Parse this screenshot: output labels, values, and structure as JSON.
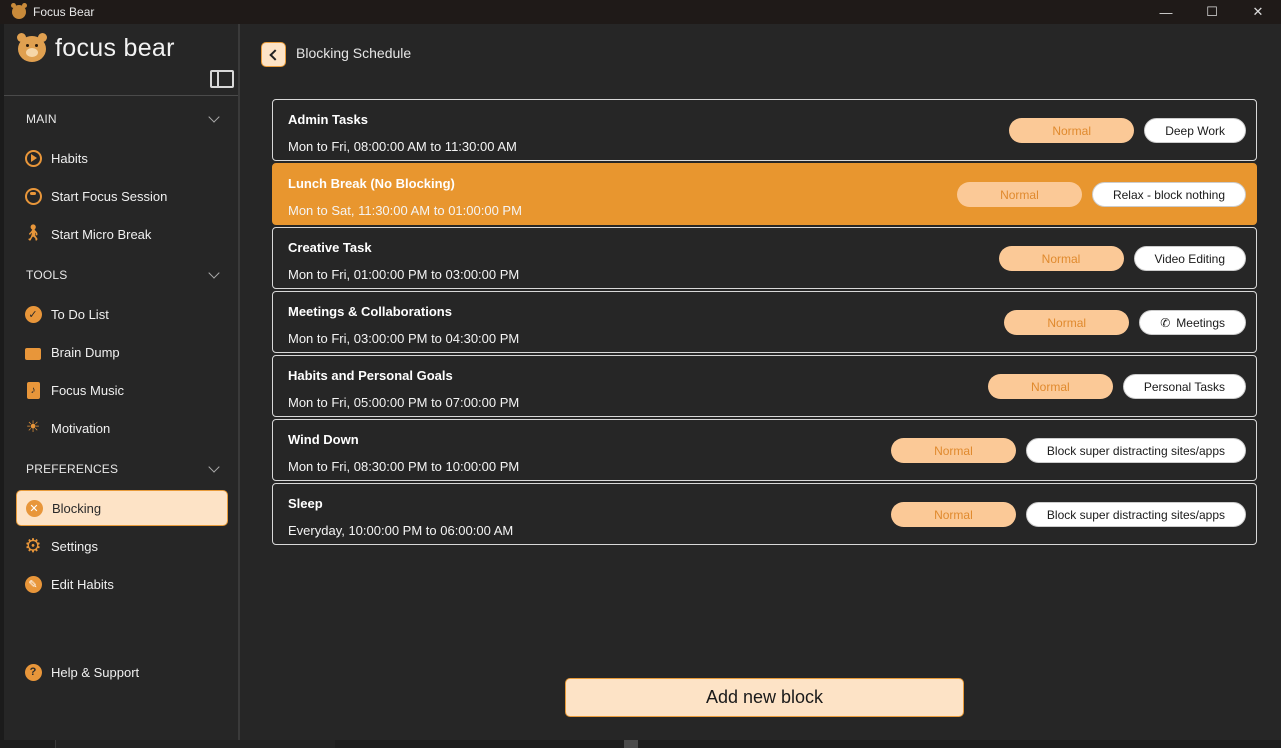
{
  "window": {
    "title": "Focus Bear"
  },
  "brand": {
    "name": "focus bear"
  },
  "sidebar": {
    "sections": [
      {
        "label": "MAIN",
        "items": [
          {
            "label": "Habits",
            "icon": "play-circle-icon"
          },
          {
            "label": "Start Focus Session",
            "icon": "timer-icon"
          },
          {
            "label": "Start Micro Break",
            "icon": "walking-person-icon"
          }
        ]
      },
      {
        "label": "TOOLS",
        "items": [
          {
            "label": "To Do List",
            "icon": "checkmark-badge-icon"
          },
          {
            "label": "Brain Dump",
            "icon": "open-box-icon"
          },
          {
            "label": "Focus Music",
            "icon": "music-note-icon"
          },
          {
            "label": "Motivation",
            "icon": "sun-icon"
          }
        ]
      },
      {
        "label": "PREFERENCES",
        "items": [
          {
            "label": "Blocking",
            "icon": "shield-x-icon",
            "active": true
          },
          {
            "label": "Settings",
            "icon": "gear-icon"
          },
          {
            "label": "Edit Habits",
            "icon": "pencil-icon"
          }
        ]
      }
    ],
    "help": {
      "label": "Help & Support",
      "icon": "question-icon"
    }
  },
  "header": {
    "title": "Blocking Schedule"
  },
  "blocks": [
    {
      "name": "Admin Tasks",
      "time": "Mon to Fri, 08:00:00 AM to 11:30:00 AM",
      "level": "Normal",
      "mode": "Deep Work"
    },
    {
      "name": "Lunch Break (No Blocking)",
      "time": "Mon to Sat, 11:30:00 AM to 01:00:00 PM",
      "level": "Normal",
      "mode": "Relax - block nothing"
    },
    {
      "name": "Creative Task",
      "time": "Mon to Fri, 01:00:00 PM to 03:00:00 PM",
      "level": "Normal",
      "mode": "Video Editing"
    },
    {
      "name": "Meetings & Collaborations",
      "time": "Mon to Fri, 03:00:00 PM to 04:30:00 PM",
      "level": "Normal",
      "mode": "Meetings"
    },
    {
      "name": "Habits and Personal Goals",
      "time": "Mon to Fri, 05:00:00 PM to 07:00:00 PM",
      "level": "Normal",
      "mode": "Personal Tasks"
    },
    {
      "name": "Wind Down",
      "time": "Mon to Fri, 08:30:00 PM to 10:00:00 PM",
      "level": "Normal",
      "mode": "Block super distracting sites/apps"
    },
    {
      "name": "Sleep",
      "time": "Everyday, 10:00:00 PM to 06:00:00 AM",
      "level": "Normal",
      "mode": "Block super distracting sites/apps"
    }
  ],
  "actions": {
    "add_block": "Add new block"
  },
  "colors": {
    "accent": "#e8962f",
    "accent_light": "#fde3c6",
    "tag_normal_bg": "#fbc997",
    "background": "#262626"
  }
}
